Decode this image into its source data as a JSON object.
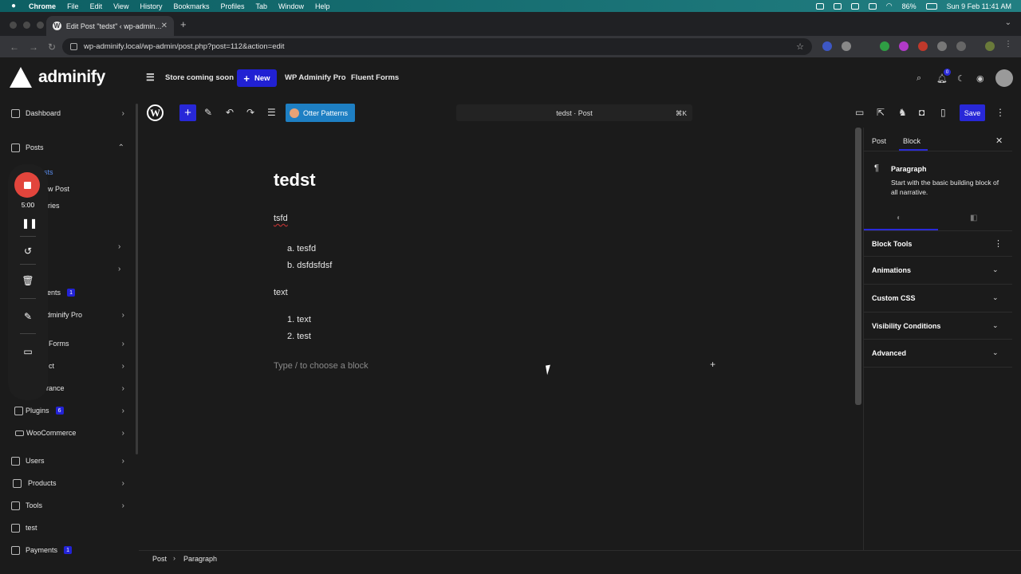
{
  "menubar": {
    "app": "Chrome",
    "items": [
      "File",
      "Edit",
      "View",
      "History",
      "Bookmarks",
      "Profiles",
      "Tab",
      "Window",
      "Help"
    ],
    "battery": "86%",
    "datetime": "Sun 9 Feb  11:41 AM"
  },
  "browser": {
    "tab_title": "Edit Post \"tedst\" ‹ wp-admin…",
    "url": "wp-adminify.local/wp-admin/post.php?post=112&action=edit"
  },
  "adminbar": {
    "brand": "adminify",
    "store_label": "Store coming soon",
    "new_label": "New",
    "pro_label": "WP Adminify Pro",
    "forms_label": "Fluent Forms",
    "notif_count": "0"
  },
  "sidebar": {
    "dashboard": "Dashboard",
    "posts": "Posts",
    "sub_all_posts": "sts",
    "sub_add_new": "ew Post",
    "sub_categories": "ories",
    "comments": "ents",
    "comments_count": "1",
    "adminify_pro": "dminify Pro",
    "forms": "Forms",
    "contact": "ct",
    "appearance": "rance",
    "plugins": "Plugins",
    "plugins_count": "6",
    "woocommerce": "WooCommerce",
    "users": "Users",
    "products": "Products",
    "tools": "Tools",
    "test": "test",
    "payments": "Payments",
    "payments_count": "1"
  },
  "recorder": {
    "time": "5:00"
  },
  "editor_toolbar": {
    "otter_label": "Otter Patterns",
    "doc_title": "tedst · Post",
    "shortcut": "⌘K",
    "save_label": "Save"
  },
  "content": {
    "title": "tedst",
    "para1": "tsfd",
    "ol_alpha": [
      "a. tesfd",
      "b. dsfdsfdsf"
    ],
    "para2": "text",
    "ol_num": [
      "1. text",
      "2. test"
    ],
    "placeholder": "Type / to choose a block"
  },
  "breadcrumb": {
    "root": "Post",
    "sep": "›",
    "current": "Paragraph"
  },
  "inspector": {
    "tab_post": "Post",
    "tab_block": "Block",
    "block_name": "Paragraph",
    "block_desc": "Start with the basic building block of all narrative.",
    "panels": [
      "Block Tools",
      "Animations",
      "Custom CSS",
      "Visibility Conditions",
      "Advanced"
    ]
  },
  "colors": {
    "accent": "#2828d8",
    "record": "#e2453c",
    "otter": "#1e7fc3",
    "background": "#1b1b1b"
  }
}
